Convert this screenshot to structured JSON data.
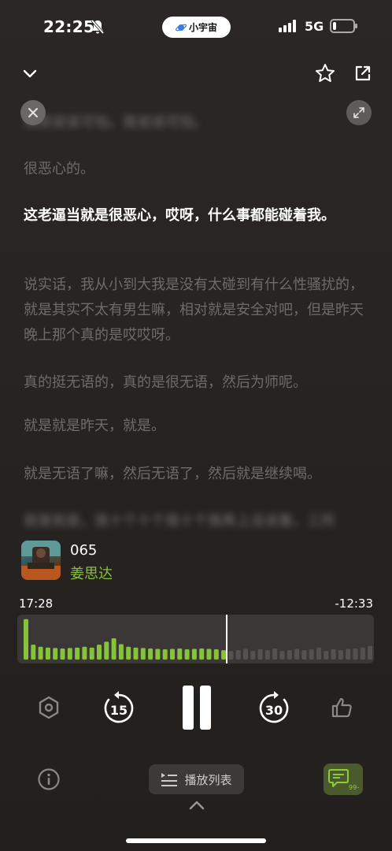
{
  "status_bar": {
    "time": "22:25",
    "pill_label": "小宇宙",
    "network": "5G",
    "battery_percent": 15
  },
  "transcript": {
    "paragraphs": [
      "我就说说可怕。我说说可怕。",
      "很恶心的。",
      "这老逼当就是很恶心，哎呀，什么事都能碰着我。",
      "说实话，我从小到大我是没有太碰到有什么性骚扰的，就是其实不太有男生嘛，相对就是安全对吧，但是昨天晚上那个真的是哎哎呀。",
      "真的挺无语的，真的是很无语，然后为师呢。",
      "就是就是昨天，就是。",
      "就是无语了嘛，然后无语了，然后就是继续喝。",
      "就是就是，我十个十个我十个我再上没说看，三所"
    ],
    "active_index": 2
  },
  "episode": {
    "title": "065",
    "author": "姜思达"
  },
  "player": {
    "elapsed": "17:28",
    "remaining": "-12:33",
    "progress_fraction": 0.585,
    "accent_color": "#86c23a"
  },
  "controls": {
    "rewind_seconds": "15",
    "forward_seconds": "30",
    "playlist_label": "播放列表",
    "comment_badge": "99+"
  }
}
